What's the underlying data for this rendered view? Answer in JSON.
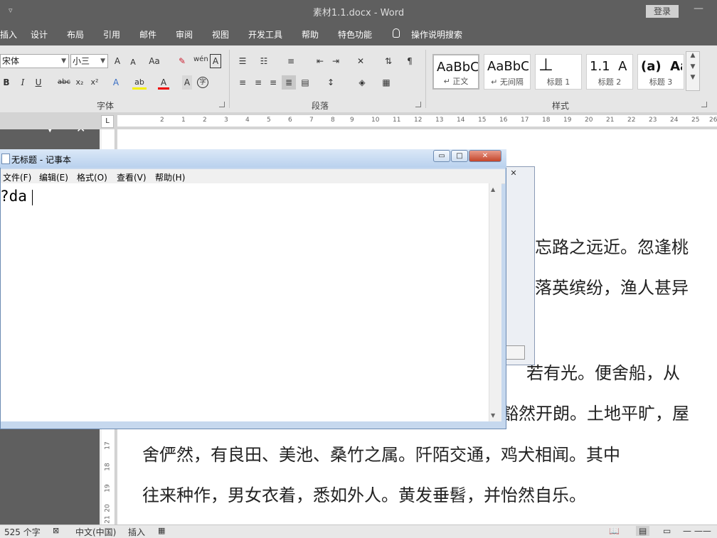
{
  "window": {
    "title": "素材1.1.docx  -  Word",
    "login_label": "登录",
    "qat_arrow": "▿",
    "min_glyph": "—"
  },
  "ribbon_tabs": [
    "插入",
    "设计",
    "布局",
    "引用",
    "邮件",
    "审阅",
    "视图",
    "开发工具",
    "帮助",
    "特色功能",
    "操作说明搜索"
  ],
  "font_group": {
    "font_name": "宋体",
    "font_size": "小三",
    "label": "字体",
    "grow": "A",
    "shrink": "A",
    "case": "Aa",
    "wen": "wén",
    "box_a": "A",
    "bold": "B",
    "italic": "I",
    "underline": "U",
    "strike": "abc",
    "sub": "x₂",
    "sup": "x²",
    "effects": "A",
    "highlight": "ab",
    "color": "A",
    "shade": "A",
    "circle": "字"
  },
  "paragraph_group": {
    "label": "段落"
  },
  "styles_group": {
    "label": "样式",
    "items": [
      {
        "sample": "AaBbCc",
        "name": "↵ 正文"
      },
      {
        "sample": "AaBbCc",
        "name": "↵ 无间隔"
      },
      {
        "sample": "⊥",
        "name": "标题 1"
      },
      {
        "sample": "1.1  A",
        "name": "标题 2"
      },
      {
        "sample": "(a)  Aa",
        "name": "标题 3"
      }
    ]
  },
  "ruler": {
    "corner": "L",
    "ticks": [
      "1",
      "2",
      "1",
      "2",
      "3",
      "4",
      "5",
      "6",
      "7",
      "8",
      "9",
      "10",
      "11",
      "12",
      "13",
      "14",
      "15",
      "16",
      "17",
      "18",
      "19",
      "20",
      "21",
      "22",
      "23",
      "24",
      "25",
      "26"
    ],
    "vticks": [
      "16",
      "17",
      "18",
      "19",
      "20",
      "21"
    ]
  },
  "nav_pane": {
    "dropdown": "▼",
    "close": "✕"
  },
  "document": {
    "right_lines": [
      "忘路之远近。忽逢桃",
      "落英缤纷，渔人甚异"
    ],
    "mid_lines": [
      "若有光。便舍船，从",
      "豁然开朗。土地平旷，屋"
    ],
    "full_lines": [
      "舍俨然，有良田、美池、桑竹之属。阡陌交通，鸡犬相闻。其中",
      "往来种作，男女衣着，悉如外人。黄发垂髫，并怡然自乐。"
    ]
  },
  "dialog": {
    "close": "✕"
  },
  "notepad": {
    "title": "无标题 - 记事本",
    "menu": [
      "文件(F)",
      "编辑(E)",
      "格式(O)",
      "查看(V)",
      "帮助(H)"
    ],
    "text": "?da",
    "ctl_min": "▭",
    "ctl_max": "□",
    "ctl_close": "✕"
  },
  "status_bar": {
    "word_count": "525 个字",
    "language": "中文(中国)",
    "mode": "插入"
  }
}
